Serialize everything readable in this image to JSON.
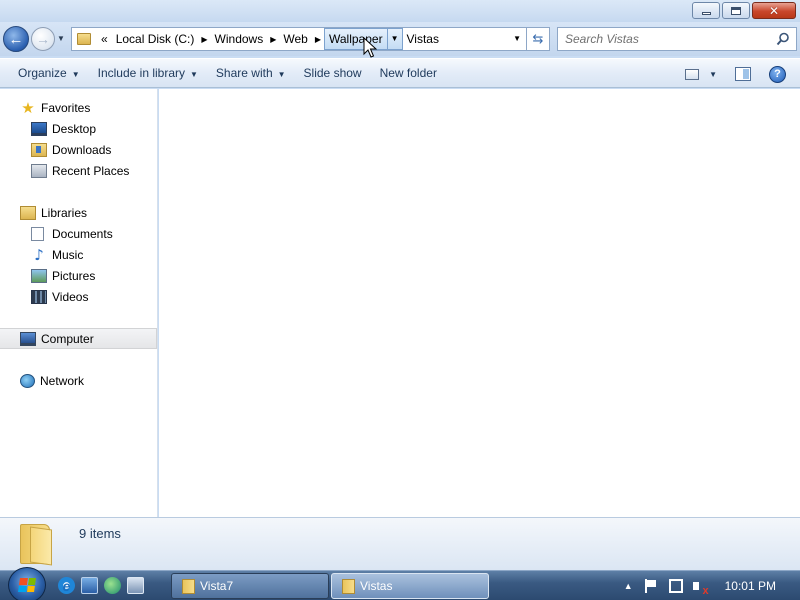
{
  "window": {
    "caption_buttons": [
      "minimize",
      "maximize",
      "close"
    ]
  },
  "address_bar": {
    "overflow": "«",
    "breadcrumbs": [
      "Local Disk (C:)",
      "Windows",
      "Web",
      "Wallpaper",
      "Vistas"
    ],
    "selected_crumb": "Wallpaper"
  },
  "search": {
    "placeholder": "Search Vistas"
  },
  "command_bar": {
    "organize": "Organize",
    "include_in_library": "Include in library",
    "share_with": "Share with",
    "slide_show": "Slide show",
    "new_folder": "New folder"
  },
  "nav_pane": {
    "favorites": "Favorites",
    "desktop": "Desktop",
    "downloads": "Downloads",
    "recent_places": "Recent Places",
    "libraries": "Libraries",
    "documents": "Documents",
    "music": "Music",
    "pictures": "Pictures",
    "videos": "Videos",
    "computer": "Computer",
    "network": "Network",
    "selected": "Computer"
  },
  "details_pane": {
    "item_count": "9 items"
  },
  "taskbar": {
    "buttons": [
      {
        "label": "Vista7",
        "active": false
      },
      {
        "label": "Vistas",
        "active": true
      }
    ],
    "clock": "10:01 PM"
  },
  "colors": {
    "accent": "#2a5fb0",
    "window_frame": "#c9dcf3",
    "taskbar": "#3a5a82",
    "close_button": "#c9462c"
  },
  "icons": {
    "nav": [
      "back-arrow-icon",
      "forward-arrow-icon"
    ],
    "tray": [
      "action-center-flag-icon",
      "network-monitor-icon",
      "volume-muted-icon"
    ]
  }
}
